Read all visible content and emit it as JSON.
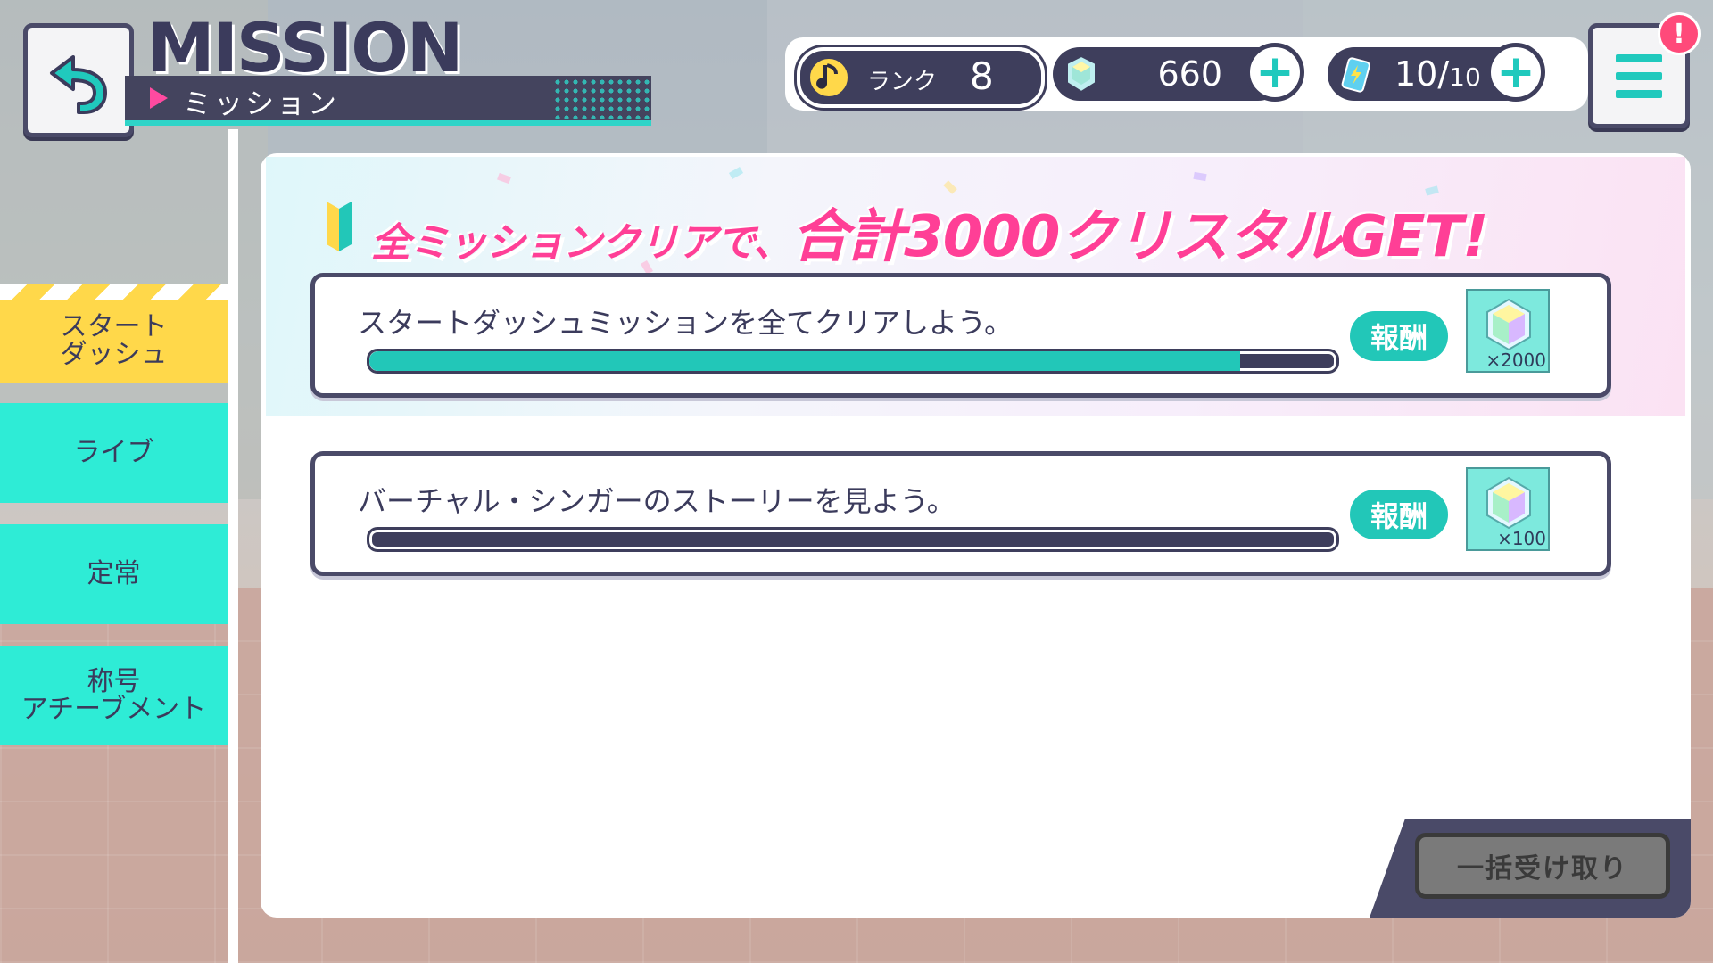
{
  "header": {
    "title": "MISSION",
    "subtitle": "ミッション"
  },
  "status": {
    "rank_label": "ランク",
    "rank_value": "8",
    "crystal_value": "660",
    "energy_value": "10/",
    "energy_max": "10"
  },
  "notification_badge": "!",
  "sidebar": {
    "items": [
      {
        "label": "スタート\nダッシュ",
        "active": true
      },
      {
        "label": "ライブ",
        "active": false
      },
      {
        "label": "定常",
        "active": false
      },
      {
        "label": "称号\nアチーブメント",
        "active": false
      }
    ]
  },
  "banner": {
    "text_part1": "全ミッションクリアで、",
    "text_part2": "合計3000クリスタルGET",
    "text_part3": "!"
  },
  "missions": [
    {
      "text": "スタートダッシュミッションを全てクリアしよう。",
      "progress": 0.9,
      "reward_label": "報酬",
      "reward_qty": "×2000"
    },
    {
      "text": "バーチャル・シンガーのストーリーを見よう。",
      "progress": 0.0,
      "reward_label": "報酬",
      "reward_qty": "×100"
    }
  ],
  "bulk_receive_label": "一括受け取り",
  "colors": {
    "accent_teal": "#22c7b8",
    "accent_pink": "#ff3f96",
    "navy": "#3e3e5c",
    "active_tab": "#ffd84a"
  }
}
